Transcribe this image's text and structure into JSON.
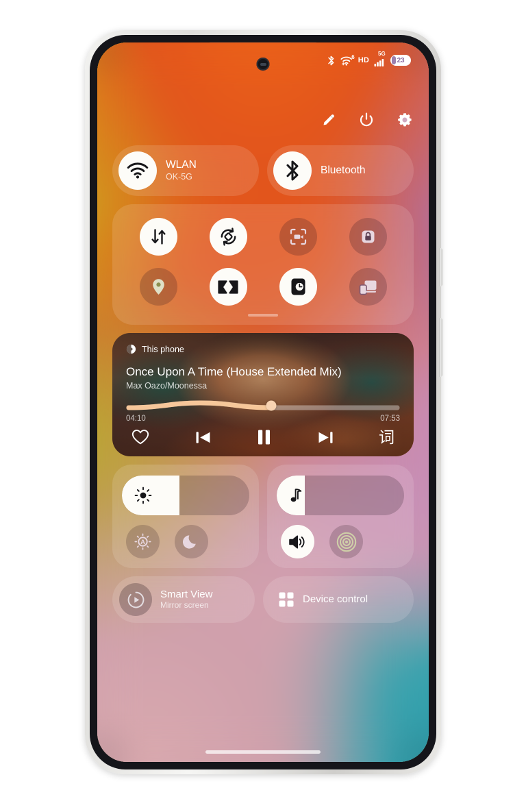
{
  "statusbar": {
    "bluetooth_icon": "bluetooth-icon",
    "wifi_icon": "wifi-icon",
    "wifi_generation": "6",
    "hd_label": "HD",
    "network_label": "5G",
    "signal_icon": "signal-bars-icon",
    "battery_level": "23"
  },
  "topactions": {
    "edit_label": "edit-icon",
    "power_label": "power-icon",
    "settings_label": "settings-icon"
  },
  "connectivity": {
    "wlan": {
      "title": "WLAN",
      "subtitle": "OK-5G",
      "icon": "wifi-icon",
      "state": "on"
    },
    "bluetooth": {
      "title": "Bluetooth",
      "subtitle": "",
      "icon": "bluetooth-icon",
      "state": "on"
    }
  },
  "toggles": [
    {
      "name": "mobile-data",
      "icon": "data-transfer-icon",
      "state": "on"
    },
    {
      "name": "auto-rotate",
      "icon": "auto-rotate-icon",
      "state": "on"
    },
    {
      "name": "screen-recorder",
      "icon": "screen-record-icon",
      "state": "off"
    },
    {
      "name": "screen-lock",
      "icon": "lock-icon",
      "state": "off"
    },
    {
      "name": "location",
      "icon": "location-pin-icon",
      "state": "off"
    },
    {
      "name": "dolby-atmos",
      "icon": "dolby-icon",
      "state": "on"
    },
    {
      "name": "always-on-display",
      "icon": "clock-panel-icon",
      "state": "on"
    },
    {
      "name": "screen-cast",
      "icon": "cast-devices-icon",
      "state": "off"
    }
  ],
  "media": {
    "source_label": "This phone",
    "source_icon": "speaker-output-icon",
    "title": "Once Upon A Time (House Extended Mix)",
    "artist": "Max Oazo/Moonessa",
    "elapsed": "04:10",
    "duration": "07:53",
    "progress_percent": 53,
    "controls": {
      "favorite": "heart-icon",
      "previous": "previous-track-icon",
      "playpause": "pause-icon",
      "next": "next-track-icon",
      "lyrics": "词"
    }
  },
  "brightness": {
    "slider_icon": "brightness-icon",
    "value_percent": 45,
    "auto_button": {
      "icon": "auto-brightness-icon",
      "state": "off"
    },
    "dark_button": {
      "icon": "moon-icon",
      "state": "off"
    }
  },
  "volume": {
    "slider_icon": "music-note-icon",
    "value_percent": 22,
    "speaker_button": {
      "icon": "speaker-icon",
      "state": "on"
    },
    "vibrate_button": {
      "icon": "vibration-icon",
      "state": "off"
    }
  },
  "bottom": {
    "smart_view": {
      "title": "Smart View",
      "subtitle": "Mirror screen",
      "icon": "smart-view-icon"
    },
    "device_control": {
      "title": "Device control",
      "icon": "grid-dots-icon"
    }
  },
  "colors": {
    "accent_white": "#fdfcf8",
    "progress_fill": "#f6c79a",
    "knob": "#f8d3b2",
    "wallpaper_yellow": "#c9b51f",
    "wallpaper_orange": "#e2541c",
    "wallpaper_purple": "#a777c0",
    "wallpaper_pink": "#d6a3b0",
    "wallpaper_teal": "#2a9aa8"
  }
}
